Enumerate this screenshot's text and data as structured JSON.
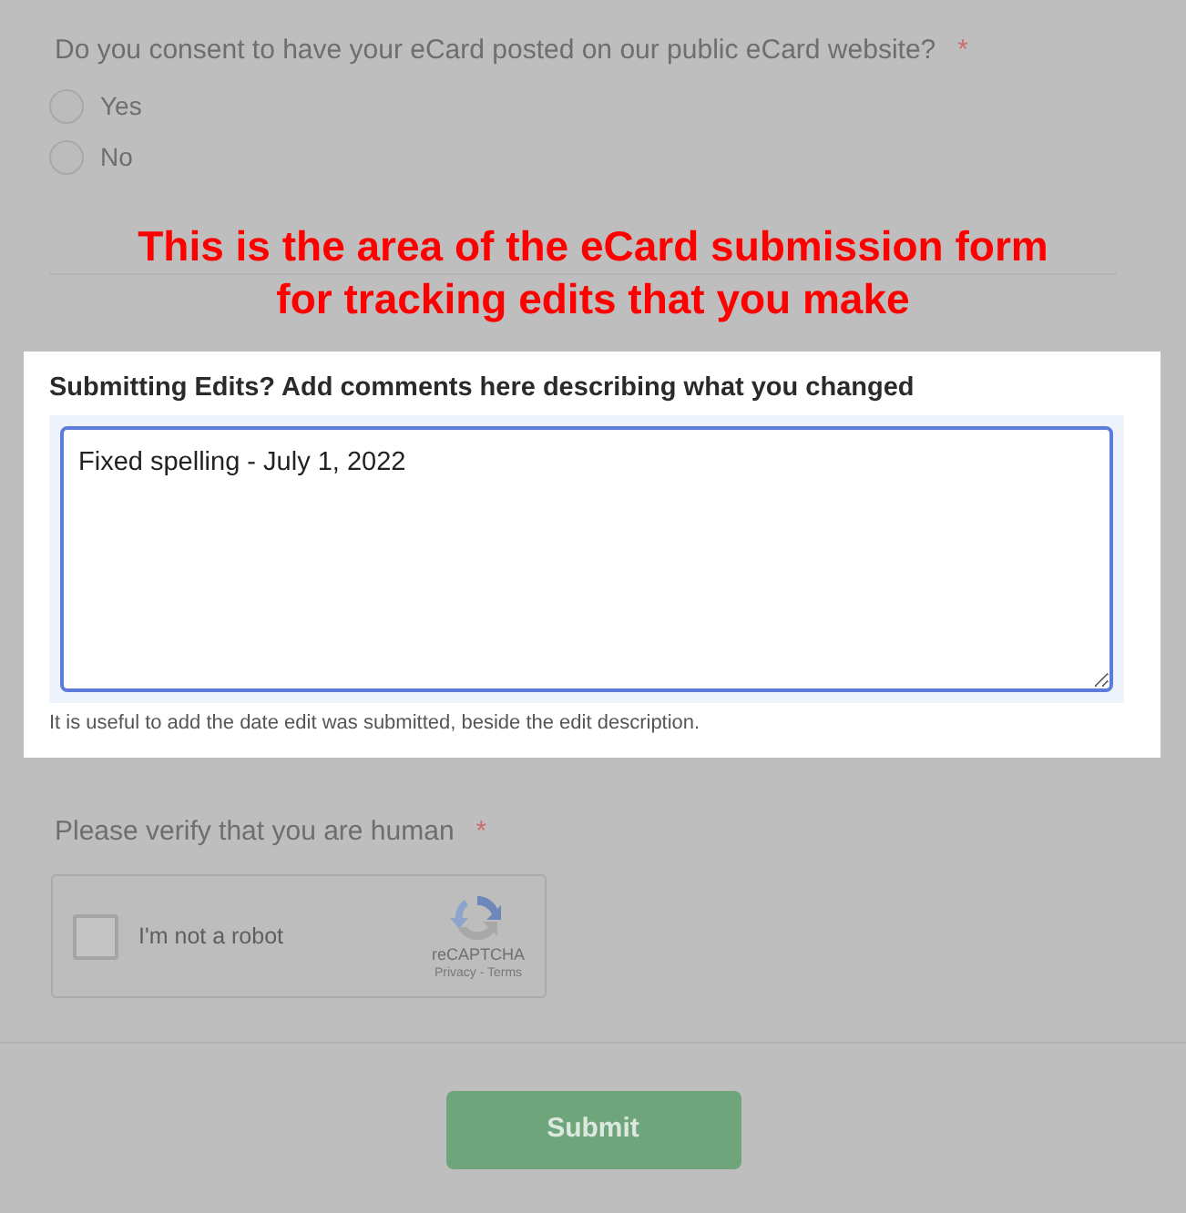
{
  "consent_question": {
    "label": "Do you consent to have your eCard posted on our public eCard website?",
    "required_mark": "*",
    "options": [
      {
        "label": "Yes",
        "selected": false
      },
      {
        "label": "No",
        "selected": false
      }
    ]
  },
  "annotation": [
    "This is the area of the eCard submission form",
    "for tracking edits that you make"
  ],
  "edits_field": {
    "label": "Submitting Edits? Add comments here describing what you changed",
    "value": "Fixed spelling - July 1, 2022",
    "help": "It is useful to add the date edit was submitted, beside the edit description."
  },
  "verify_question": {
    "label": "Please verify that you are human",
    "required_mark": "*"
  },
  "captcha": {
    "label": "I'm not a robot",
    "checked": false,
    "brand": "reCAPTCHA",
    "links": "Privacy - Terms"
  },
  "submit_button": {
    "label": "Submit"
  }
}
